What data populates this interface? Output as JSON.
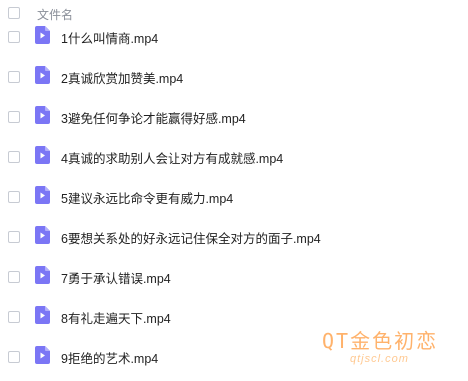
{
  "header": {
    "column_title": "文件名"
  },
  "files": [
    {
      "name": "1什么叫情商.mp4"
    },
    {
      "name": "2真诚欣赏加赞美.mp4"
    },
    {
      "name": "3避免任何争论才能赢得好感.mp4"
    },
    {
      "name": "4真诚的求助别人会让对方有成就感.mp4"
    },
    {
      "name": "5建议永远比命令更有威力.mp4"
    },
    {
      "name": "6要想关系处的好永远记住保全对方的面子.mp4"
    },
    {
      "name": "7勇于承认错误.mp4"
    },
    {
      "name": "8有礼走遍天下.mp4"
    },
    {
      "name": "9拒绝的艺术.mp4"
    }
  ],
  "icon": {
    "name": "video-file-icon",
    "color": "#7b76f5",
    "fold_color": "#b3b0fb"
  },
  "watermark": {
    "main": "QT金色初恋",
    "sub": "qtjscl.com"
  }
}
